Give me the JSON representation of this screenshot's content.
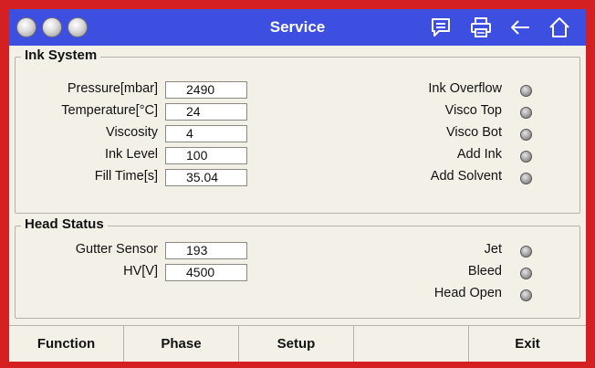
{
  "window": {
    "title": "Service",
    "icons": [
      "message-icon",
      "printer-icon",
      "back-arrow-icon",
      "home-icon"
    ]
  },
  "ink_system": {
    "title": "Ink System",
    "fields": [
      {
        "label": "Pressure[mbar]",
        "value": "2490"
      },
      {
        "label": "Temperature[°C]",
        "value": "24"
      },
      {
        "label": "Viscosity",
        "value": "4"
      },
      {
        "label": "Ink Level",
        "value": "100"
      },
      {
        "label": "Fill Time[s]",
        "value": "35.04"
      }
    ],
    "indicators": [
      {
        "label": "Ink Overflow",
        "state": "off"
      },
      {
        "label": "Visco Top",
        "state": "off"
      },
      {
        "label": "Visco Bot",
        "state": "off"
      },
      {
        "label": "Add Ink",
        "state": "off"
      },
      {
        "label": "Add Solvent",
        "state": "off"
      }
    ]
  },
  "head_status": {
    "title": "Head Status",
    "fields": [
      {
        "label": "Gutter Sensor",
        "value": "193"
      },
      {
        "label": "HV[V]",
        "value": "4500"
      }
    ],
    "indicators": [
      {
        "label": "Jet",
        "state": "off"
      },
      {
        "label": "Bleed",
        "state": "off"
      },
      {
        "label": "Head Open",
        "state": "off"
      }
    ]
  },
  "tabs": [
    {
      "label": "Function"
    },
    {
      "label": "Phase"
    },
    {
      "label": "Setup"
    },
    {
      "label": ""
    },
    {
      "label": "Exit"
    }
  ],
  "colors": {
    "frame": "#d42020",
    "titlebar": "#3d4fe0",
    "panel": "#f3f0e8"
  }
}
